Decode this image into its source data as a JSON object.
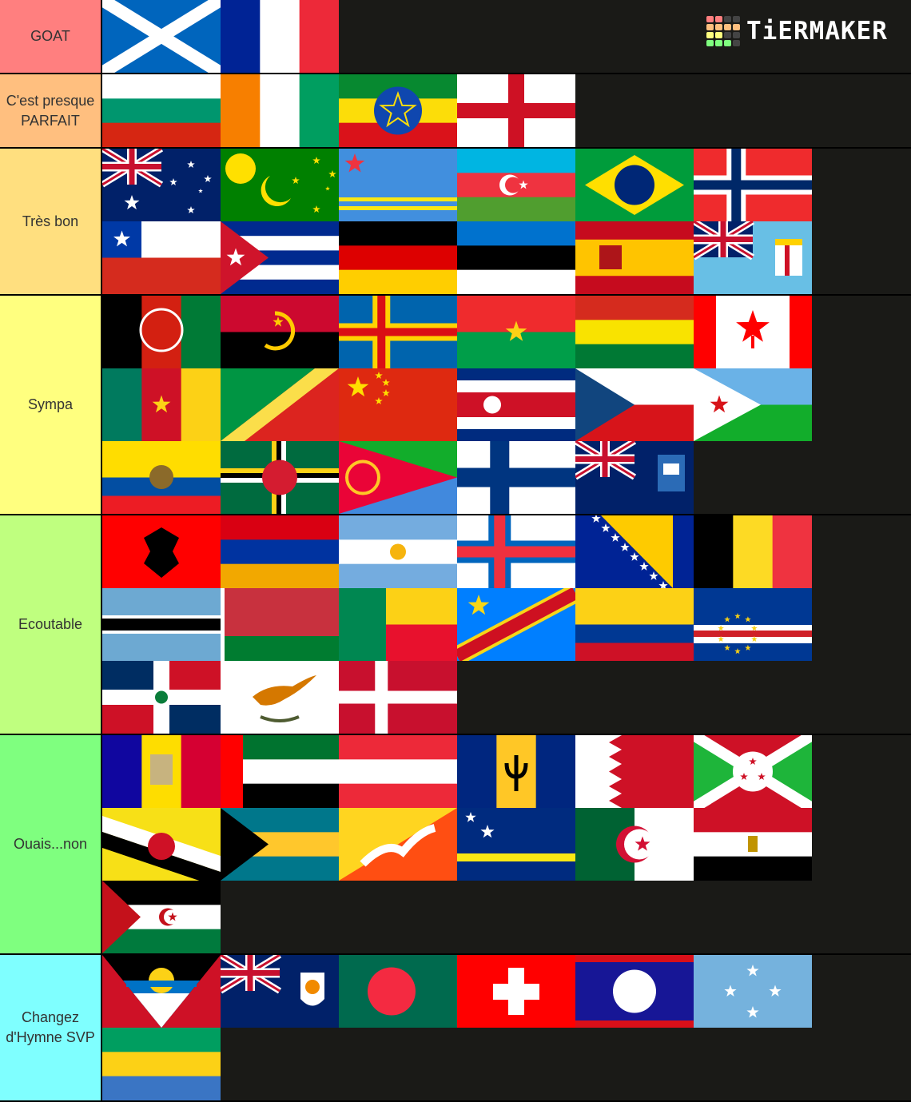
{
  "app": {
    "logo_text": "TiERMAKER",
    "logo_grid": [
      "#ff7f7f",
      "#ff7f7f",
      "#444",
      "#444",
      "#ffbf7f",
      "#ffbf7f",
      "#ffbf7f",
      "#ffbf7f",
      "#ffff7f",
      "#ffff7f",
      "#444",
      "#444",
      "#7fff7f",
      "#7fff7f",
      "#7fff7f",
      "#444"
    ]
  },
  "tiers": [
    {
      "label": "GOAT",
      "color": "#ff7f7f",
      "rows": 1,
      "items": [
        "scotland",
        "france"
      ]
    },
    {
      "label": "C'est presque PARFAIT",
      "color": "#ffbf7f",
      "rows": 1,
      "items": [
        "bulgaria",
        "ivory-coast",
        "ethiopia",
        "england"
      ]
    },
    {
      "label": "Très bon",
      "color": "#ffdf7f",
      "rows": 2,
      "items": [
        "australia",
        "cocos-islands",
        "aruba",
        "azerbaijan",
        "brazil",
        "norway",
        "chile",
        "cuba",
        "germany",
        "estonia",
        "spain",
        "fiji"
      ]
    },
    {
      "label": "Sympa",
      "color": "#ffff7f",
      "rows": 3,
      "items": [
        "afghanistan",
        "angola",
        "aland",
        "burkina-faso",
        "bolivia",
        "canada",
        "cameroon",
        "congo",
        "china",
        "costa-rica",
        "czechia",
        "djibouti",
        "ecuador",
        "dominica",
        "eritrea",
        "finland",
        "falkland-islands"
      ]
    },
    {
      "label": "Ecoutable",
      "color": "#bfff7f",
      "rows": 3,
      "items": [
        "albania",
        "armenia",
        "argentina",
        "faroe-islands",
        "bosnia",
        "belgium",
        "botswana",
        "belarus",
        "benin",
        "dr-congo",
        "colombia",
        "cape-verde",
        "dominican-republic",
        "cyprus",
        "denmark"
      ]
    },
    {
      "label": "Ouais...non",
      "color": "#7fff7f",
      "rows": 3,
      "items": [
        "andorra",
        "uae",
        "austria",
        "barbados",
        "bahrain",
        "burundi",
        "brunei",
        "bahamas",
        "bhutan",
        "curacao",
        "algeria",
        "egypt",
        "western-sahara"
      ]
    },
    {
      "label": "Changez d'Hymne SVP",
      "color": "#7fffff",
      "rows": 2,
      "items": [
        "antigua",
        "anguilla",
        "bangladesh",
        "switzerland",
        "belize",
        "micronesia",
        "gabon"
      ]
    }
  ]
}
